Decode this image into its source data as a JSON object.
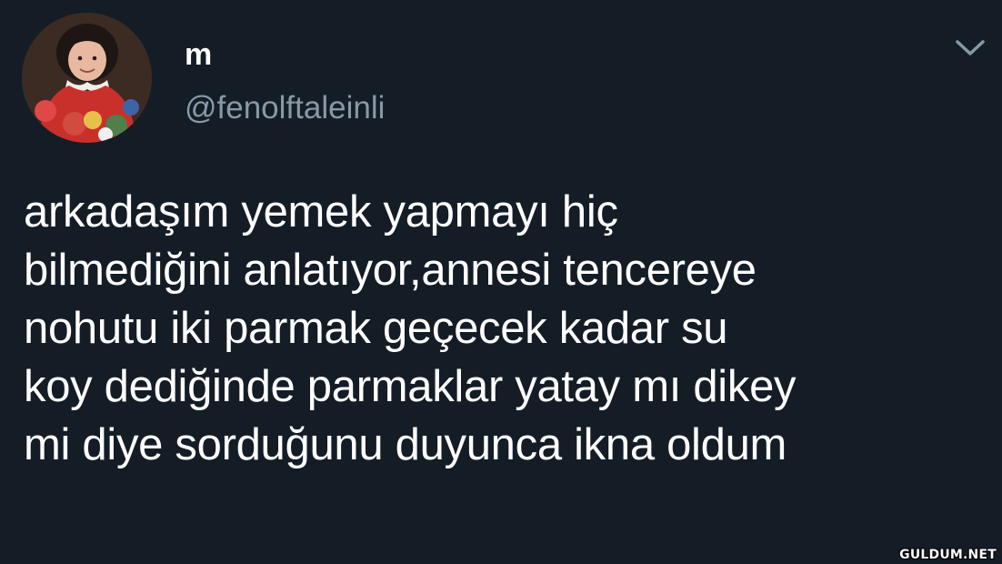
{
  "tweet": {
    "display_name": "m",
    "handle": "@fenolftaleinli",
    "text": "arkadaşım yemek yapmayı hiç\nbilmediğini anlatıyor,annesi tencereye\nnohutu iki parmak geçecek kadar su\nkoy dediğinde parmaklar yatay mı dikey\nmi diye sorduğunu duyunca ikna oldum",
    "menu_icon": "chevron-down-icon",
    "avatar_icon": "profile-photo"
  },
  "watermark": "GULDUM.NET",
  "colors": {
    "background": "#141d26",
    "text": "#ffffff",
    "handle": "#8899a6",
    "chevron": "#8899a6"
  }
}
